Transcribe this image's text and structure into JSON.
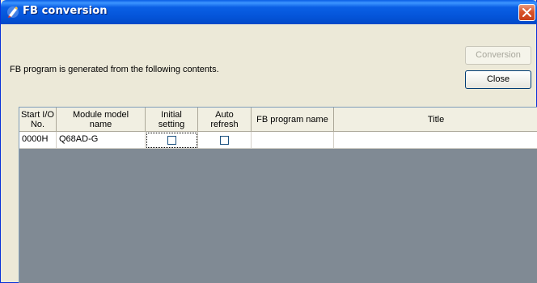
{
  "window": {
    "title": "FB conversion"
  },
  "description": "FB program is generated from the following contents.",
  "buttons": {
    "conversion": "Conversion",
    "close": "Close"
  },
  "table": {
    "headers": [
      "Start I/O\nNo.",
      "Module model\nname",
      "Initial\nsetting",
      "Auto\nrefresh",
      "FB program name",
      "Title"
    ],
    "rows": [
      {
        "start_io": "0000H",
        "module_model": "Q68AD-G",
        "initial_setting": false,
        "auto_refresh": false,
        "fb_program_name": "",
        "title": ""
      }
    ]
  },
  "colors": {
    "titlebar": "#0A5FE5",
    "window_bg": "#ECE9D8",
    "grid_bg": "#808A94"
  }
}
